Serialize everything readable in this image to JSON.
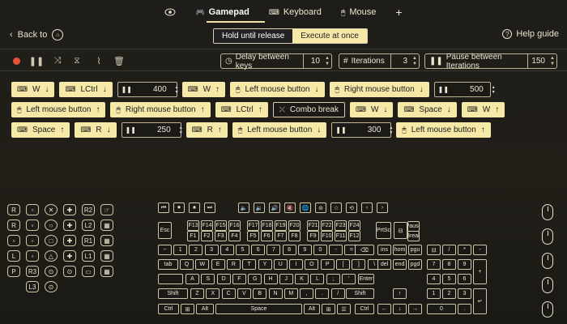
{
  "tabs": [
    {
      "label": "Gamepad",
      "active": true
    },
    {
      "label": "Keyboard",
      "active": false
    },
    {
      "label": "Mouse",
      "active": false
    }
  ],
  "header": {
    "back": "Back to",
    "help": "Help guide"
  },
  "mode": {
    "hold": "Hold until release",
    "execute": "Execute at once"
  },
  "toolbar": {
    "delay": {
      "label": "Delay between keys",
      "value": "10"
    },
    "iterations": {
      "label": "Iterations",
      "value": "3"
    },
    "pause": {
      "label": "Pause between Iterations",
      "value": "150"
    }
  },
  "sequence": [
    [
      {
        "k": "chip",
        "icon": "keyboard",
        "t": "W",
        "a": "↓"
      },
      {
        "k": "chip",
        "icon": "keyboard",
        "t": "LCtrl",
        "a": "↓"
      },
      {
        "k": "num",
        "t": "400"
      },
      {
        "k": "chip",
        "icon": "keyboard",
        "t": "W",
        "a": "↑"
      },
      {
        "k": "chip",
        "icon": "mouse",
        "t": "Left mouse button",
        "a": "↓"
      },
      {
        "k": "chip",
        "icon": "mouse",
        "t": "Right mouse button",
        "a": "↓"
      },
      {
        "k": "num",
        "t": "500"
      }
    ],
    [
      {
        "k": "chip",
        "icon": "mouse",
        "t": "Left mouse button",
        "a": "↑"
      },
      {
        "k": "chip",
        "icon": "mouse",
        "t": "Right mouse button",
        "a": "↑"
      },
      {
        "k": "chip",
        "icon": "keyboard",
        "t": "LCtrl",
        "a": "↑"
      },
      {
        "k": "dark",
        "icon": "combo",
        "t": "Combo break",
        "a": ""
      },
      {
        "k": "chip",
        "icon": "keyboard",
        "t": "W",
        "a": "↓"
      },
      {
        "k": "chip",
        "icon": "keyboard",
        "t": "Space",
        "a": "↓"
      },
      {
        "k": "chip",
        "icon": "keyboard",
        "t": "W",
        "a": "↑"
      }
    ],
    [
      {
        "k": "chip",
        "icon": "keyboard",
        "t": "Space",
        "a": "↑"
      },
      {
        "k": "chip",
        "icon": "keyboard",
        "t": "R",
        "a": "↓"
      },
      {
        "k": "num",
        "t": "250"
      },
      {
        "k": "chip",
        "icon": "keyboard",
        "t": "R",
        "a": "↑"
      },
      {
        "k": "chip",
        "icon": "mouse",
        "t": "Left mouse button",
        "a": "↓"
      },
      {
        "k": "num",
        "t": "300"
      },
      {
        "k": "chip",
        "icon": "mouse",
        "t": "Left mouse button",
        "a": "↑"
      }
    ]
  ],
  "keyboard": {
    "fn1": [
      "F13",
      "F14",
      "F15",
      "F16",
      "F17",
      "F18",
      "F19",
      "F20",
      "F21",
      "F22",
      "F23",
      "F24"
    ],
    "fn2": [
      "F1",
      "F2",
      "F3",
      "F4",
      "F5",
      "F6",
      "F7",
      "F8",
      "F9",
      "F10",
      "F11",
      "F12"
    ],
    "esc": "Esc",
    "num_row": [
      "~",
      "1",
      "2",
      "3",
      "4",
      "5",
      "6",
      "7",
      "8",
      "9",
      "0",
      "-",
      "="
    ],
    "q_row": [
      "tab",
      "Q",
      "W",
      "E",
      "R",
      "T",
      "Y",
      "U",
      "I",
      "O",
      "P",
      "[",
      "]",
      "\\"
    ],
    "a_row": [
      "A",
      "S",
      "D",
      "F",
      "G",
      "H",
      "J",
      "K",
      "L",
      ";",
      "'",
      "Enter"
    ],
    "z_row": [
      "Shift",
      "Z",
      "X",
      "C",
      "V",
      "B",
      "N",
      "M",
      ",",
      ".",
      "/",
      "Shift"
    ],
    "bottom": {
      "ctrl": "Ctrl",
      "alt": "Alt",
      "space": "Space",
      "alt2": "Alt",
      "ctrl2": "Ctrl"
    },
    "sys": [
      "PrtSc",
      "Pause",
      "Break"
    ],
    "nav": [
      "ins",
      "hom",
      "pgu",
      "del",
      "end",
      "pgd"
    ],
    "numpad": [
      "/",
      "*",
      "-",
      "7",
      "8",
      "9",
      "+",
      "4",
      "5",
      "6",
      "1",
      "2",
      "3",
      "0",
      "."
    ]
  },
  "gamepad": {
    "labels": [
      "R2",
      "L2",
      "R1",
      "L1",
      "R3",
      "L3"
    ]
  }
}
